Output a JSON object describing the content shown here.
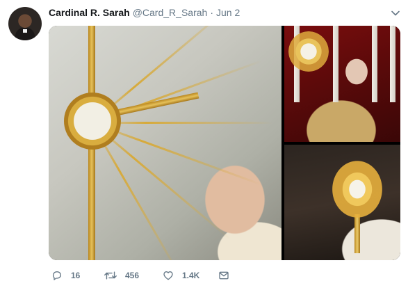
{
  "tweet": {
    "author": {
      "name": "Cardinal R. Sarah",
      "handle": "@Card_R_Sarah",
      "separator": "·",
      "date": "Jun 2",
      "avatar_icon": "profile-photo"
    },
    "menu_icon": "chevron-down-icon",
    "media": {
      "count": 3,
      "items": [
        {
          "description_icon": "photo-monstrance-pope"
        },
        {
          "description_icon": "photo-monstrance-candles"
        },
        {
          "description_icon": "photo-monstrance-dark"
        }
      ]
    },
    "actions": {
      "reply": {
        "icon": "reply-icon",
        "count": "16"
      },
      "retweet": {
        "icon": "retweet-icon",
        "count": "456"
      },
      "like": {
        "icon": "heart-icon",
        "count": "1.4K"
      },
      "message": {
        "icon": "envelope-icon"
      }
    },
    "colors": {
      "name": "#14171a",
      "secondary": "#657786"
    }
  }
}
